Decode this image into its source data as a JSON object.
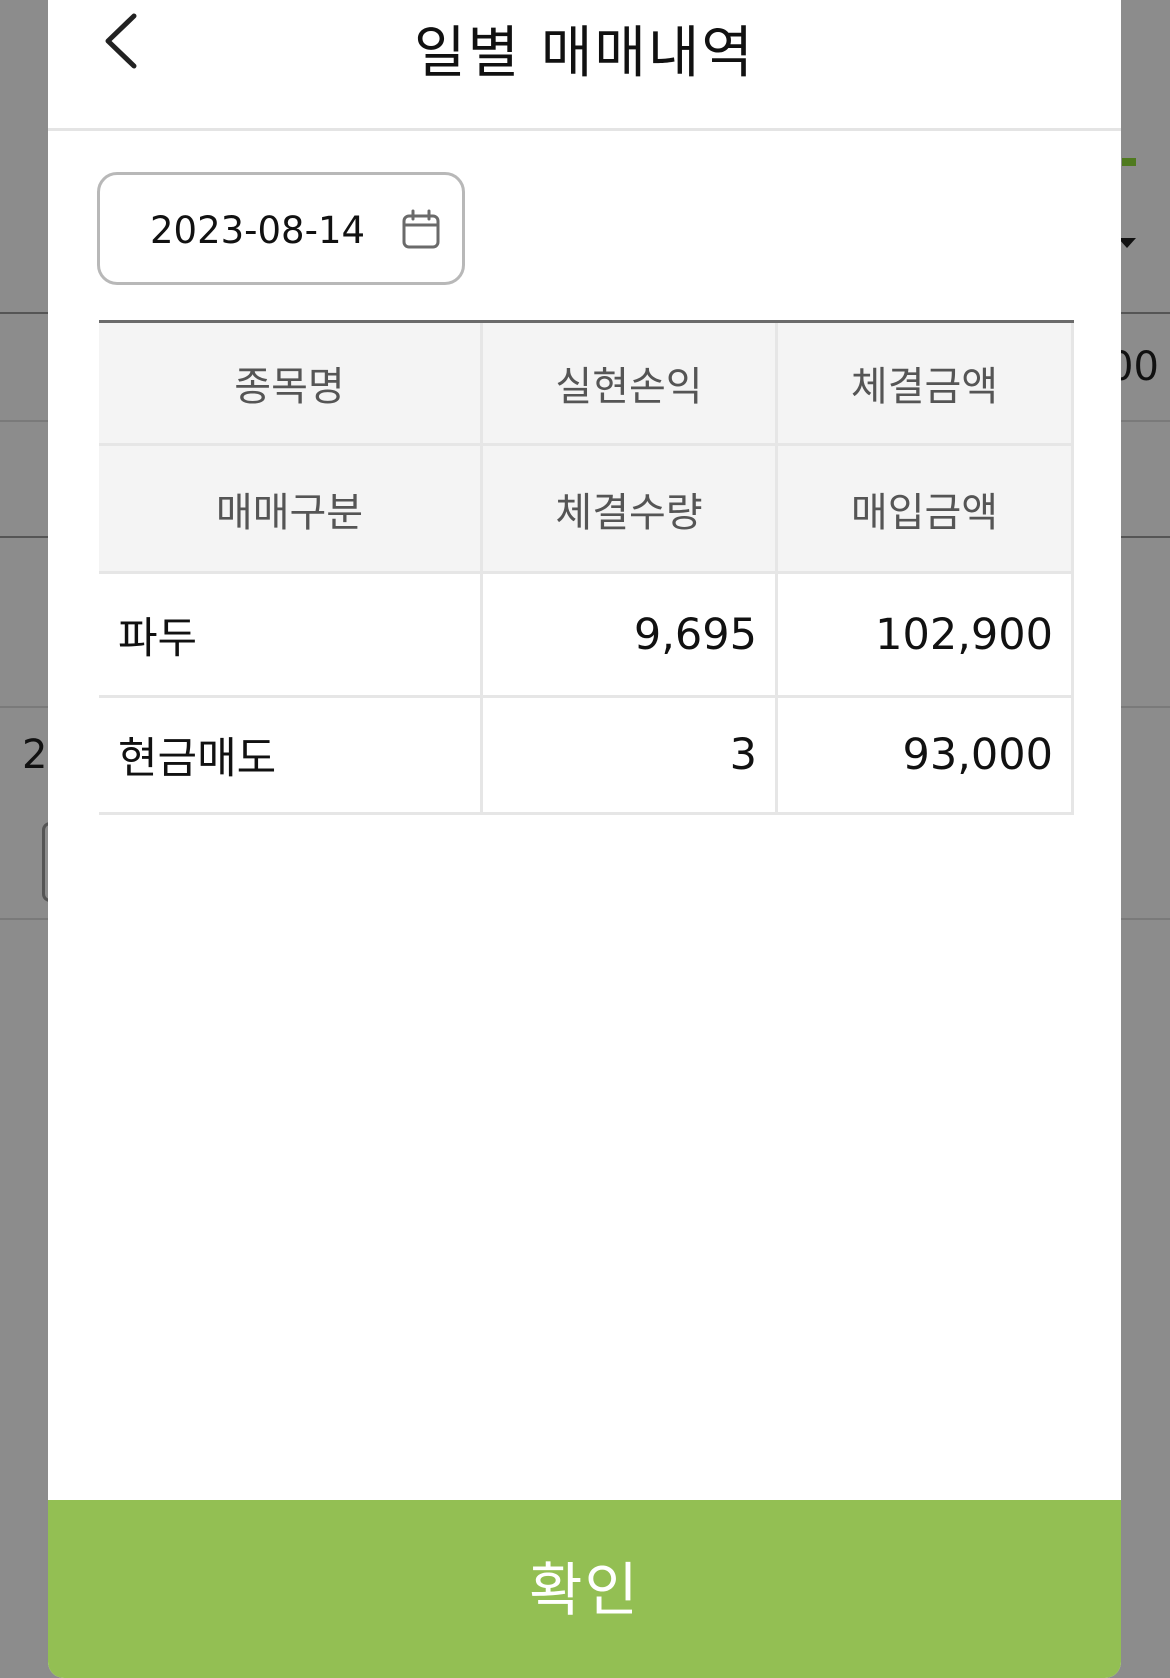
{
  "background": {
    "partial_text_left": "2",
    "partial_text_right": "00"
  },
  "header": {
    "title": "일별 매매내역",
    "back_icon": "chevron-left-icon"
  },
  "date_picker": {
    "value": "2023-08-14",
    "icon": "calendar-icon"
  },
  "table": {
    "headers_row1": [
      "종목명",
      "실현손익",
      "체결금액"
    ],
    "headers_row2": [
      "매매구분",
      "체결수량",
      "매입금액"
    ],
    "rows": [
      {
        "name": "파두",
        "realized_profit": "9,695",
        "execution_amount": "102,900",
        "trade_type": "현금매도",
        "execution_qty": "3",
        "purchase_amount": "93,000"
      }
    ]
  },
  "confirm_button": {
    "label": "확인"
  },
  "colors": {
    "accent": "#93bf53",
    "profit_positive": "#d9463d",
    "dim_overlay": "#8c8c8c"
  }
}
